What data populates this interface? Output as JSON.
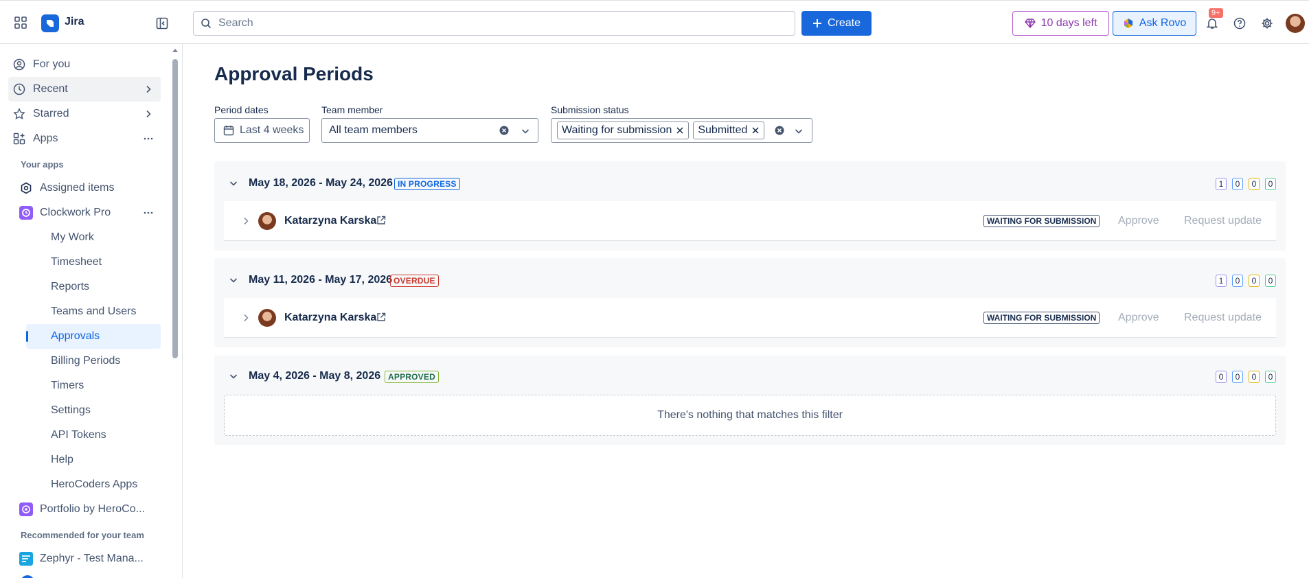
{
  "topbar": {
    "product": "Jira",
    "search_placeholder": "Search",
    "create_label": "Create",
    "trial_label": "10 days left",
    "rovo_label": "Ask Rovo",
    "notifications_badge": "9+"
  },
  "sidebar": {
    "top_items": [
      {
        "label": "For you",
        "icon": "user-circle-icon"
      },
      {
        "label": "Recent",
        "icon": "clock-icon"
      },
      {
        "label": "Starred",
        "icon": "star-icon"
      },
      {
        "label": "Apps",
        "icon": "apps-icon"
      }
    ],
    "your_apps_heading": "Your apps",
    "assigned_items": "Assigned items",
    "clockwork": "Clockwork Pro",
    "clockwork_items": [
      "My Work",
      "Timesheet",
      "Reports",
      "Teams and Users",
      "Approvals",
      "Billing Periods",
      "Timers",
      "Settings",
      "API Tokens",
      "Help",
      "HeroCoders Apps"
    ],
    "active_item": "Approvals",
    "portfolio": "Portfolio by HeroCo...",
    "recommended_heading": "Recommended for your team",
    "zephyr": "Zephyr - Test Mana..."
  },
  "main": {
    "title": "Approval Periods",
    "filters": {
      "period_label": "Period dates",
      "period_value": "Last 4 weeks",
      "member_label": "Team member",
      "member_value": "All team members",
      "status_label": "Submission status",
      "status_chips": [
        "Waiting for submission",
        "Submitted"
      ]
    },
    "periods": [
      {
        "range": "May 18, 2026 - May 24, 2026",
        "status": "IN PROGRESS",
        "counts": [
          "1",
          "0",
          "0",
          "0"
        ],
        "rows": [
          {
            "name": "Katarzyna Karska",
            "status": "WAITING FOR SUBMISSION",
            "approve": "Approve",
            "request": "Request update"
          }
        ]
      },
      {
        "range": "May 11, 2026 - May 17, 2026",
        "status": "OVERDUE",
        "counts": [
          "1",
          "0",
          "0",
          "0"
        ],
        "rows": [
          {
            "name": "Katarzyna Karska",
            "status": "WAITING FOR SUBMISSION",
            "approve": "Approve",
            "request": "Request update"
          }
        ]
      },
      {
        "range": "May 4, 2026 - May 8, 2026",
        "status": "APPROVED",
        "counts": [
          "0",
          "0",
          "0",
          "0"
        ],
        "empty": "There's nothing that matches this filter"
      }
    ]
  },
  "colors": {
    "accent": "#1868db",
    "inprogress": "#0c66e4",
    "overdue": "#c9372c",
    "approved": "#216e4e",
    "count_purple": "#9f8fef",
    "count_blue": "#579dff",
    "count_orange": "#e2b203",
    "count_green": "#4bce97"
  }
}
